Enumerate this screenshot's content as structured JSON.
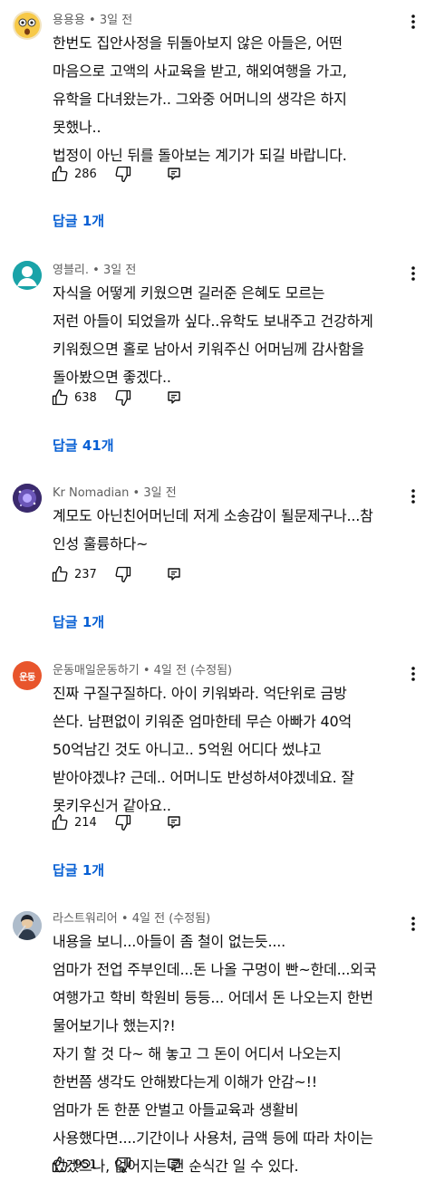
{
  "comments": [
    {
      "author": "용용용",
      "time": "3일 전",
      "edited": "",
      "text": "한번도 집안사정을 뒤돌아보지 않은 아들은, 어떤\n마음으로 고액의 사교육을 받고, 해외여행을 가고,\n유학을 다녀왔는가.. 그와중 어머니의 생각은 하지\n못했나..\n법정이 아닌 뒤를 돌아보는 계기가 되길 바랍니다.",
      "likes": "286",
      "replies": "답글 1개",
      "avatar_icon": "surprised-emoji-icon"
    },
    {
      "author": "영블리.",
      "time": "3일 전",
      "edited": "",
      "text": "자식을 어떻게 키웠으면 길러준 은혜도 모르는\n저런 아들이 되었을까 싶다..유학도 보내주고 건강하게\n키워줬으면 홀로 남아서 키워주신 어머님께 감사함을\n돌아봤으면 좋겠다..",
      "likes": "638",
      "replies": "답글 41개",
      "avatar_icon": "teal-person-icon"
    },
    {
      "author": "Kr Nomadian",
      "time": "3일 전",
      "edited": "",
      "text": "계모도 아닌친어머닌데 저게 소송감이 될문제구나...참\n인성 훌륭하다~",
      "likes": "237",
      "replies": "답글 1개",
      "avatar_icon": "galaxy-icon"
    },
    {
      "author": "운동매일운동하기",
      "time": "4일 전",
      "edited": "(수정됨)",
      "avatar_text": "운동",
      "text": "진짜 구질구질하다. 아이 키워봐라. 억단위로 금방\n쓴다. 남편없이 키워준 엄마한테 무슨 아빠가 40억\n50억남긴 것도 아니고.. 5억원 어디다 썼냐고\n받아야겠냐? 근데.. 어머니도 반성하셔야겠네요. 잘\n못키우신거 같아요..",
      "likes": "214",
      "replies": "답글 1개",
      "avatar_icon": "orange-text-avatar"
    },
    {
      "author": "라스트워리어",
      "time": "4일 전",
      "edited": "(수정됨)",
      "text": "내용을 보니...아들이 좀 철이 없는듯....\n엄마가 전업 주부인데...돈 나올 구멍이 빤~한데...외국\n여행가고 학비 학원비 등등... 어데서 돈 나오는지 한번\n물어보기나 했는지?!\n자기 할 것 다~ 해 놓고 그 돈이 어디서 나오는지\n한번쯤 생각도 안해봤다는게 이해가 안감~!!\n엄마가 돈 한푼 안벌고 아들교육과 생활비\n사용했다면....기간이나 사용처, 금액 등에 따라 차이는\n있겠으나, 없어지는 건 순식간 일 수 있다.",
      "likes": "951",
      "replies": "",
      "avatar_icon": "warrior-figure-icon"
    }
  ],
  "colors": {
    "text": "#0f0f0f",
    "meta": "#606060",
    "link": "#065fd4"
  }
}
